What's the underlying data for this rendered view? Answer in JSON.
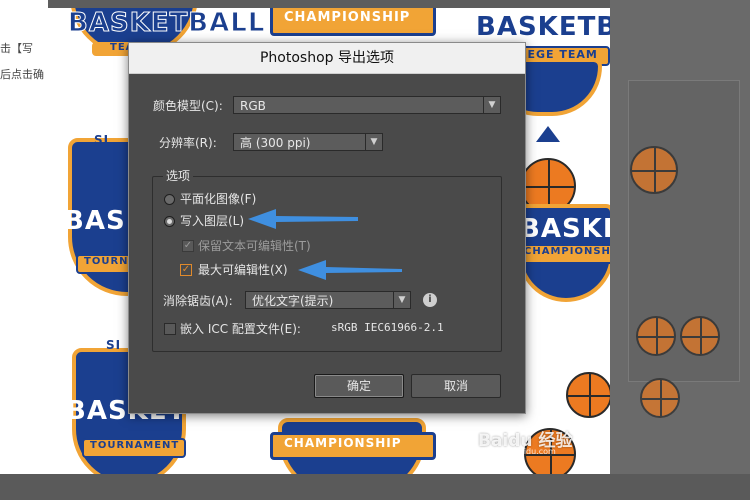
{
  "background": {
    "left_text": [
      "击【写",
      "后点击确"
    ],
    "art_words": [
      "BASKETBALL",
      "CHAMPIONSHIP",
      "BASKETBALL",
      "COLLEGE TEAM",
      "TEA",
      "BASKETBALL",
      "TOURNAMENT",
      "BASKETBALL",
      "CHAMPIONSHIP",
      "BASKETBALL",
      "TOURNAMENT",
      "CHAMPIONSHIP",
      "SI",
      "SI"
    ],
    "watermark": "Baidu 经验",
    "watermark_sub": "jingyan.baidu.com"
  },
  "dialog": {
    "title": "Photoshop 导出选项",
    "color_model_label": "颜色模型(C):",
    "color_model_value": "RGB",
    "resolution_label": "分辨率(R):",
    "resolution_value": "高 (300 ppi)",
    "options_group_title": "选项",
    "flat_image_label": "平面化图像(F)",
    "write_layers_label": "写入图层(L)",
    "preserve_text_label": "保留文本可编辑性(T)",
    "max_editability_label": "最大可编辑性(X)",
    "antialias_label": "消除锯齿(A):",
    "antialias_value": "优化文字(提示)",
    "embed_icc_label": "嵌入 ICC 配置文件(E):",
    "embed_icc_profile": "sRGB IEC61966-2.1",
    "ok_label": "确定",
    "cancel_label": "取消",
    "selected_mode": "写入图层(L)",
    "checkbox_states": {
      "preserve_text": true,
      "max_editability": true,
      "embed_icc": false
    }
  },
  "colors": {
    "annotation_arrow": "#3f8fe0",
    "checkbox_accent": "#e08a2c",
    "badge_blue": "#1b3f8f",
    "badge_orange": "#f1a436"
  }
}
